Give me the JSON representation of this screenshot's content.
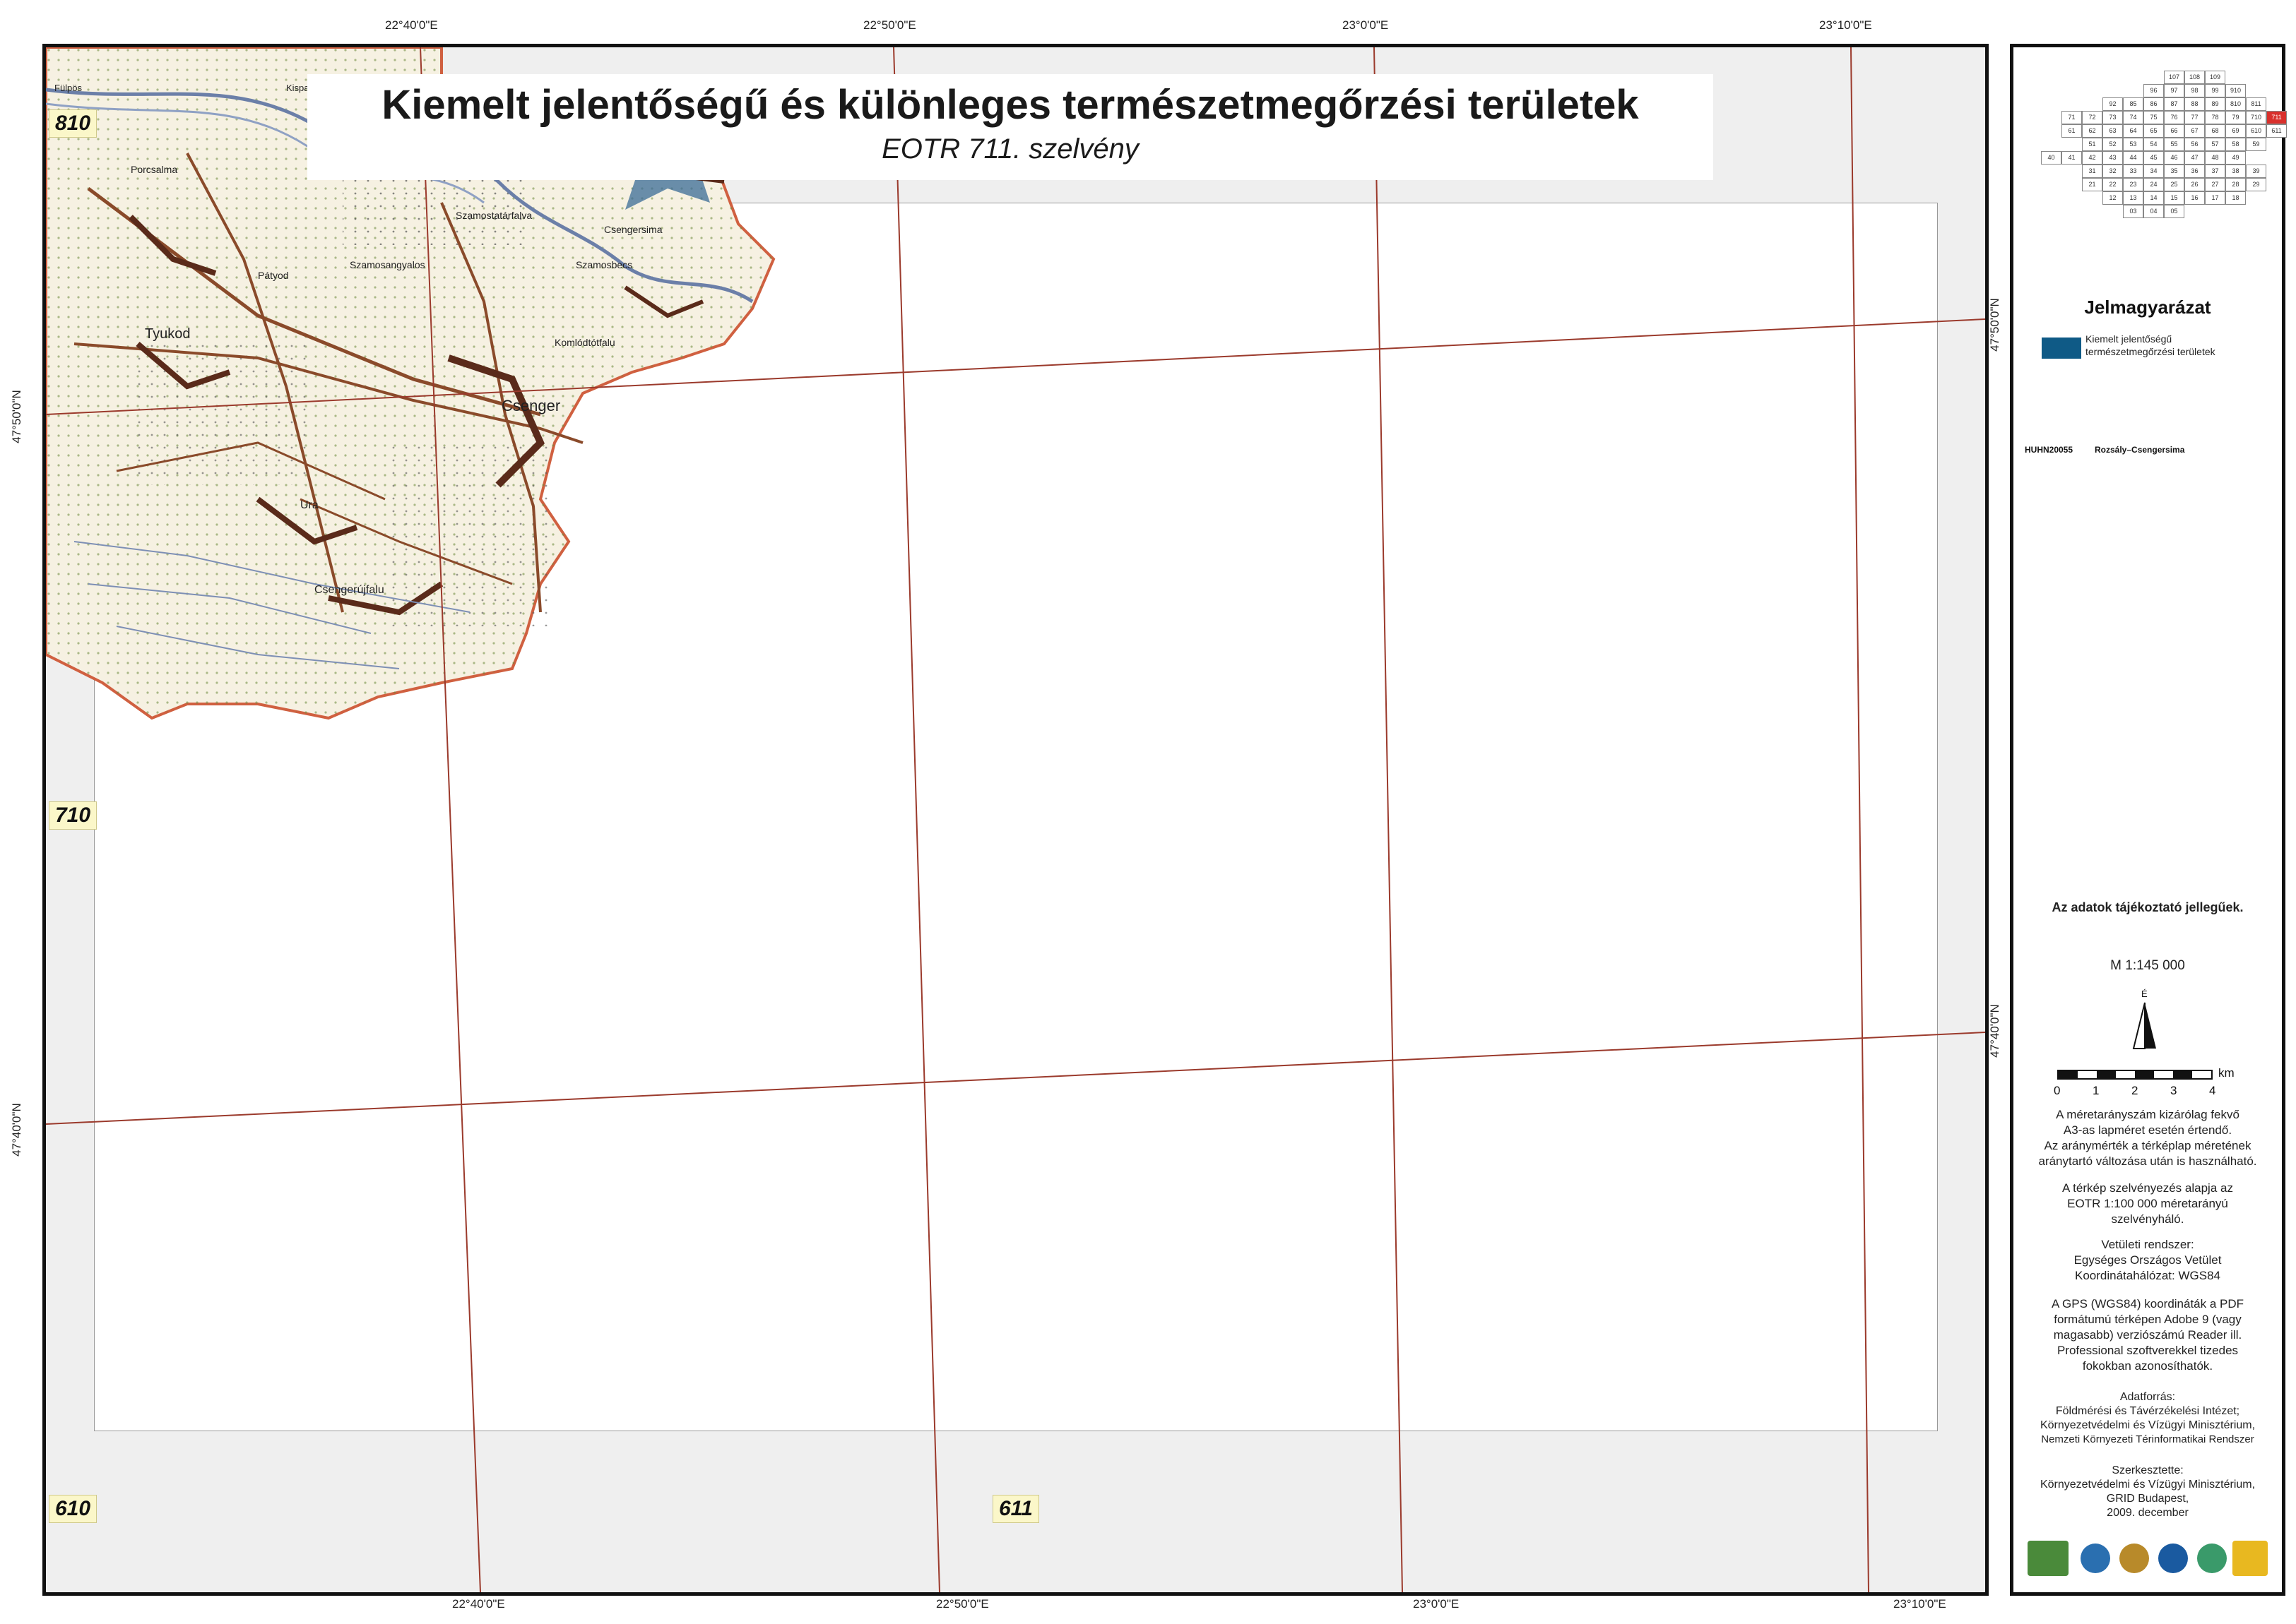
{
  "title": "Kiemelt jelentőségű és különleges természetmegőrzési területek",
  "subtitle": "EOTR 711. szelvény",
  "sheet_labels": {
    "top_left": "810",
    "mid_left": "710",
    "bottom_left": "610",
    "bottom_center": "611"
  },
  "coords_top": [
    "22°40'0\"E",
    "22°50'0\"E",
    "23°0'0\"E",
    "23°10'0\"E"
  ],
  "coords_bottom": [
    "22°40'0\"E",
    "22°50'0\"E",
    "23°0'0\"E",
    "23°10'0\"E"
  ],
  "coords_left": [
    "47°50'0\"N",
    "47°40'0\"N"
  ],
  "coords_right": [
    "47°50'0\"N",
    "47°40'0\"N"
  ],
  "map_places": [
    "Porcsalma",
    "Tyukod",
    "Pátyod",
    "Szamosangyalos",
    "Szamostatárfalva",
    "Szamosbecs",
    "Csengersima",
    "Komlódtótfalu",
    "Csenger",
    "Ura",
    "Csengerújfalu",
    "Fülpös",
    "Kispalád"
  ],
  "index_map": {
    "rows": [
      [
        "107",
        "108",
        "109"
      ],
      [
        "96",
        "97",
        "98",
        "99",
        "910"
      ],
      [
        "92",
        "85",
        "86",
        "87",
        "88",
        "89",
        "810",
        "811"
      ],
      [
        "71",
        "72",
        "73",
        "74",
        "75",
        "76",
        "77",
        "78",
        "79",
        "710",
        "711"
      ],
      [
        "61",
        "62",
        "63",
        "64",
        "65",
        "66",
        "67",
        "68",
        "69",
        "610",
        "611"
      ],
      [
        "51",
        "52",
        "53",
        "54",
        "55",
        "56",
        "57",
        "58",
        "59"
      ],
      [
        "40",
        "41",
        "42",
        "43",
        "44",
        "45",
        "46",
        "47",
        "48",
        "49"
      ],
      [
        "31",
        "32",
        "33",
        "34",
        "35",
        "36",
        "37",
        "38",
        "39"
      ],
      [
        "21",
        "22",
        "23",
        "24",
        "25",
        "26",
        "27",
        "28",
        "29"
      ],
      [
        "12",
        "13",
        "14",
        "15",
        "16",
        "17",
        "18"
      ],
      [
        "03",
        "04",
        "05"
      ]
    ],
    "highlight": "711"
  },
  "legend": {
    "heading": "Jelmagyarázat",
    "item_label_1": "Kiemelt jelentőségű",
    "item_label_2": "természetmegőrzési területek",
    "site_code": "HUHN20055",
    "site_name": "Rozsály–Csengersima"
  },
  "notes": {
    "disclaimer": "Az adatok tájékoztató jellegűek.",
    "scale": "M 1:145 000",
    "north": "É",
    "scalebar_unit": "km",
    "scalebar_ticks": [
      "0",
      "1",
      "2",
      "3",
      "4"
    ],
    "scale_note_1": "A méretarányszám kizárólag fekvő",
    "scale_note_2": "A3-as lapméret esetén értendő.",
    "scale_note_3": "Az aránymérték a térképlap méretének",
    "scale_note_4": "aránytartó változása után is használható.",
    "grid_note_1": "A térkép szelvényezés alapja az",
    "grid_note_2": "EOTR 1:100 000 méretarányú",
    "grid_note_3": "szelvényháló.",
    "proj_1": "Vetületi rendszer:",
    "proj_2": "Egységes Országos Vetület",
    "proj_3": "Koordinátahálózat: WGS84",
    "gps_1": "A GPS (WGS84) koordináták a PDF",
    "gps_2": "formátumú térképen Adobe 9 (vagy",
    "gps_3": "magasabb) verziószámú Reader ill.",
    "gps_4": "Professional szoftverekkel tizedes",
    "gps_5": "fokokban azonosíthatók.",
    "src_1": "Adatforrás:",
    "src_2": "Földmérési és Távérzékelési Intézet;",
    "src_3": "Környezetvédelmi és Vízügyi Minisztérium,",
    "src_4": "Nemzeti Környezeti Térinformatikai Rendszer",
    "ed_1": "Szerkesztette:",
    "ed_2": "Környezetvédelmi és Vízügyi Minisztérium,",
    "ed_3": "GRID Budapest,",
    "ed_4": "2009. december"
  },
  "colors": {
    "natura_fill": "#0f5a86",
    "grid_line": "#9b3a2c",
    "sheet_label_bg": "#fbf7c9",
    "boundary": "#d06040",
    "index_highlight": "#d9302c"
  }
}
